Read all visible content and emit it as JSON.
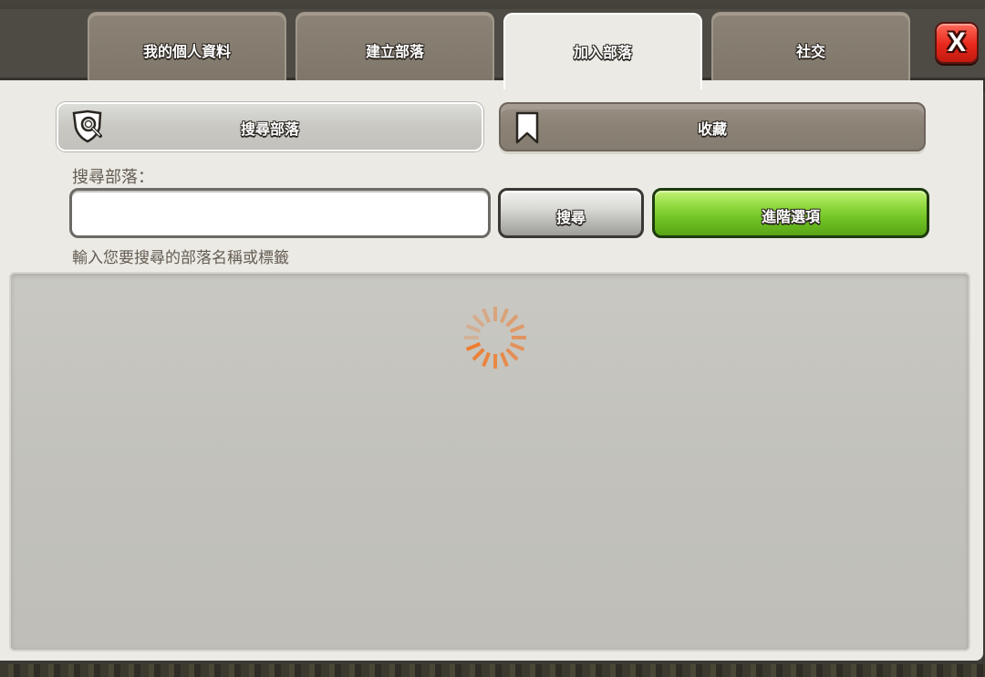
{
  "tabs": [
    {
      "label": "我的個人資料"
    },
    {
      "label": "建立部落"
    },
    {
      "label": "加入部落"
    },
    {
      "label": "社交"
    }
  ],
  "active_tab": "加入部落",
  "close_button": {
    "label": "X"
  },
  "subtabs": {
    "search": {
      "label": "搜尋部落",
      "icon": "shield-search-icon"
    },
    "bookmark": {
      "label": "收藏",
      "icon": "bookmark-icon"
    }
  },
  "search": {
    "caption": "搜尋部落：",
    "value": "",
    "placeholder": "",
    "button_label": "搜尋",
    "advanced_label": "進階選項",
    "hint": "輸入您要搜尋的部落名稱或標籤"
  },
  "results": {
    "loading": true,
    "spinner_icon": "loading-spinner-icon"
  },
  "colors": {
    "panel": "#ebeae4",
    "advanced_button": "#6fc124",
    "close_button": "#e8281b",
    "spinner": "#f07a2a"
  }
}
